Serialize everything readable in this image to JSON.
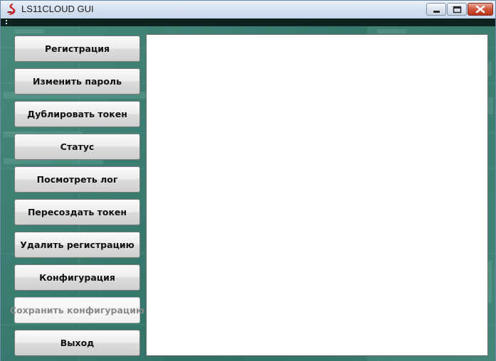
{
  "window": {
    "title": "LS11CLOUD GUI",
    "icons": {
      "app": "ls11-logo-icon",
      "minimize": "minimize-icon",
      "maximize": "maximize-icon",
      "close": "close-icon"
    }
  },
  "sidebar": {
    "buttons": [
      {
        "label": "Регистрация",
        "enabled": true
      },
      {
        "label": "Изменить пароль",
        "enabled": true
      },
      {
        "label": "Дублировать токен",
        "enabled": true
      },
      {
        "label": "Статус",
        "enabled": true
      },
      {
        "label": "Посмотреть лог",
        "enabled": true
      },
      {
        "label": "Пересоздать токен",
        "enabled": true
      },
      {
        "label": "Удалить регистрацию",
        "enabled": true
      },
      {
        "label": "Конфигурация",
        "enabled": true
      },
      {
        "label": "Сохранить конфигурацию",
        "enabled": false
      },
      {
        "label": "Выход",
        "enabled": true
      }
    ]
  },
  "output": {
    "text": ""
  },
  "colors": {
    "background_teal": "#3c7f72",
    "title_bar": "#d3e0f0",
    "close_button": "#c9452b",
    "disabled_text": "#8a8a8a"
  }
}
